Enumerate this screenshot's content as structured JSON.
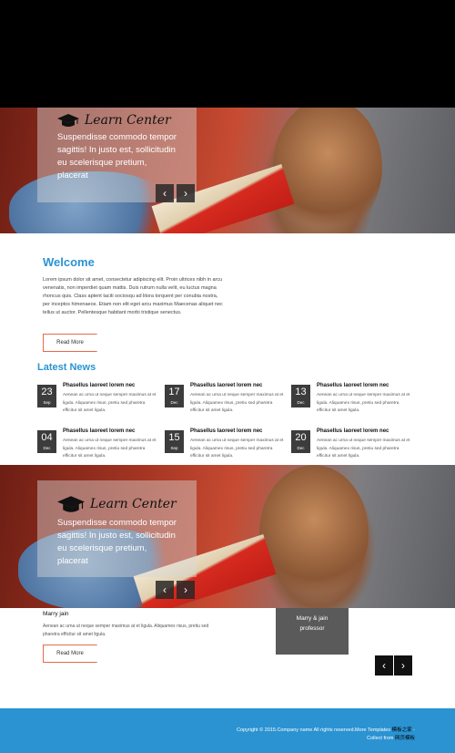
{
  "brand": {
    "logo_text": "Learn Center"
  },
  "hero": {
    "caption_text": "Suspendisse commodo tempor sagittis! In justo est, sollicitudin eu scelerisque pretium, placerat",
    "prev_arrow": "‹",
    "next_arrow": "›"
  },
  "welcome": {
    "title": "Welcome",
    "body": "Lorem ipsum dolor sit amet, consectetur adipiscing elit. Proin ultrices nibh in arcu venenatis, non imperdiet quam mattis. Duis rutrum nulla velit, eu luctus magna rhoncus quis. Class aptent taciti sociosqu ad litora torquent per conubia nostra, per inceptos himenaeos. Etiam non elit eget arcu maximus Maecenas aliquet nec tellus ut auctor. Pellentesque habitant morbi tristique senectus.",
    "read_more": "Read More"
  },
  "news": {
    "title": "Latest News",
    "items": [
      {
        "day": "23",
        "month": "Sep",
        "title": "Phasellus laoreet lorem nec",
        "text": "Aenean ac urna ut neque semper maximus at et ligula. Aliquamex risus, pretiu sed pharetra efficitur sit amet ligula."
      },
      {
        "day": "17",
        "month": "Dec",
        "title": "Phasellus laoreet lorem nec",
        "text": "Aenean ac urna ut neque semper maximus at et ligula. Aliquamex risus, pretiu sed pharetra efficitur sit amet ligula."
      },
      {
        "day": "13",
        "month": "Dec",
        "title": "Phasellus laoreet lorem nec",
        "text": "Aenean ac urna ut neque semper maximus at et ligula. Aliquamex risus, pretiu sed pharetra efficitur sit amet ligula."
      },
      {
        "day": "04",
        "month": "Dec",
        "title": "Phasellus laoreet lorem nec",
        "text": "Aenean ac urna ut neque semper maximus at et ligula. Aliquamex risus, pretiu sed pharetra efficitur sit amet ligula."
      },
      {
        "day": "15",
        "month": "Sep",
        "title": "Phasellus laoreet lorem nec",
        "text": "Aenean ac urna ut neque semper maximus at et ligula. Aliquamex risus, pretiu sed pharetra efficitur sit amet ligula."
      },
      {
        "day": "20",
        "month": "Dec",
        "title": "Phasellus laoreet lorem nec",
        "text": "Aenean ac urna ut neque semper maximus at et ligula. Aliquamex risus, pretiu sed pharetra efficitur sit amet ligula."
      }
    ]
  },
  "testimonial": {
    "name": "Marry jain",
    "text": "Aenean ac urna ut neque semper maximus at et ligula. Aliquamex risus, pretiu sed pharetra efficitur sit amet ligula.",
    "read_more": "Read More",
    "card_name": "Marry & jain",
    "card_role": "professor",
    "prev_arrow": "‹",
    "next_arrow": "›"
  },
  "footer": {
    "copyright": "Copyright © 2015.Company name All rights reserved.More Templates",
    "link1": "模板之家",
    "collect": " - Collect from ",
    "link2": "网页模板"
  },
  "colors": {
    "accent": "#2b93d2",
    "button_border": "#e36b4b",
    "footer_bg": "#2b93d2"
  },
  "icons": [
    "graduation-cap-icon",
    "chevron-left-icon",
    "chevron-right-icon"
  ]
}
